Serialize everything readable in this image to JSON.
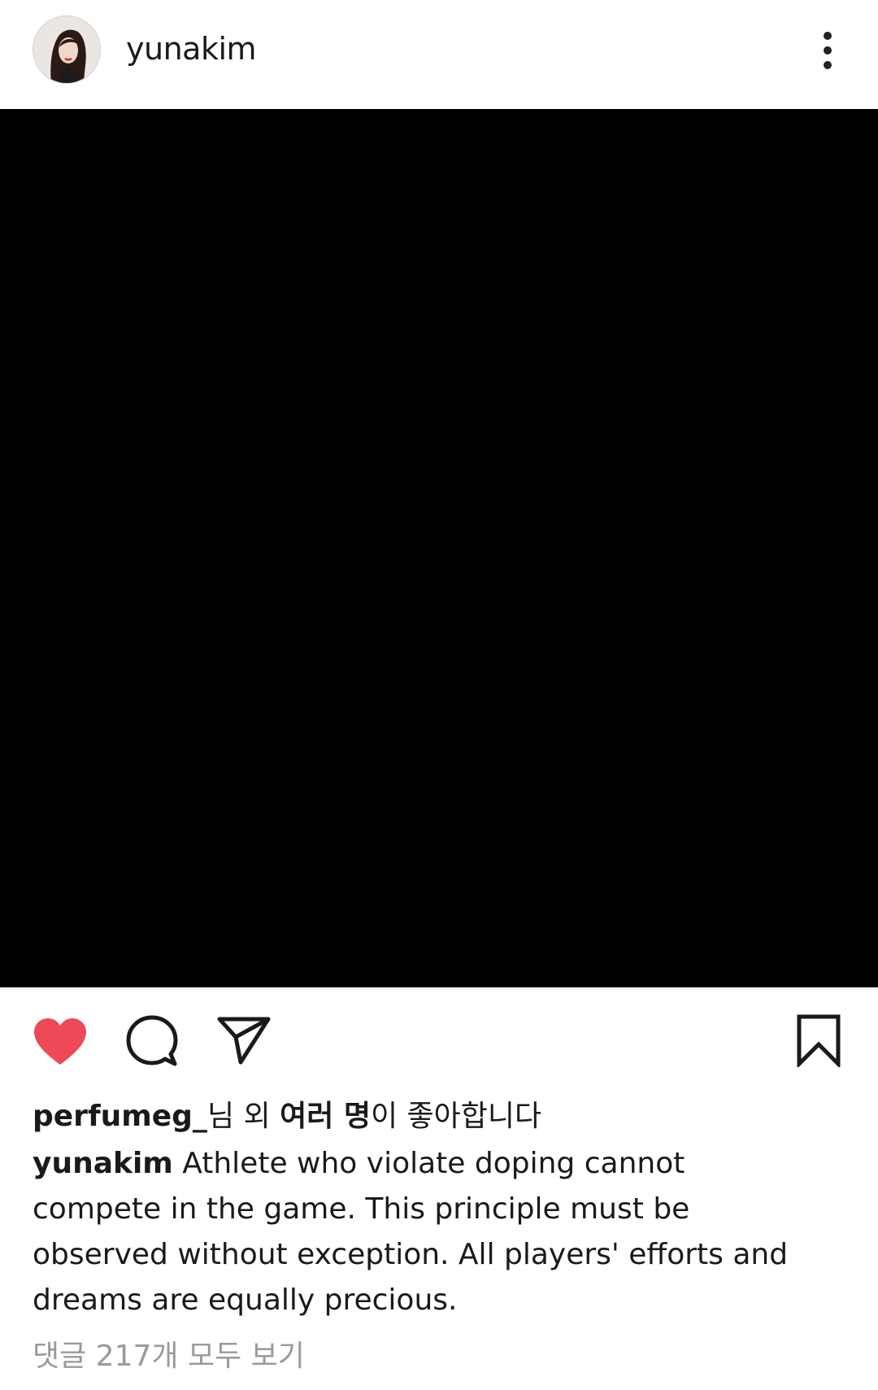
{
  "post": {
    "author": {
      "username": "yunakim"
    },
    "likes": {
      "first_user": "perfumeg_",
      "connector": "님 외 ",
      "others_bold": "여러 명",
      "suffix": "이 좋아합니다"
    },
    "caption": {
      "username": "yunakim",
      "text": " Athlete who violate doping cannot compete in the game. This principle must be observed without exception. All players' efforts and dreams are equally precious."
    },
    "view_comments_label": "댓글 217개 모두 보기",
    "liked": true
  },
  "icons": {
    "avatar": "profile-photo",
    "more": "more-vertical-icon",
    "like": "heart-filled-icon",
    "comment": "speech-bubble-icon",
    "share": "paper-plane-icon",
    "save": "bookmark-icon"
  },
  "colors": {
    "like_red": "#ed4956",
    "media_background": "#000000",
    "muted_text": "#9a9a9a"
  }
}
